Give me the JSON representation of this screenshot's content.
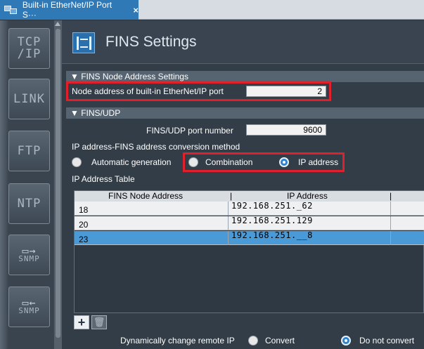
{
  "tab": {
    "title": "Built-in EtherNet/IP Port S···",
    "close": "×"
  },
  "sidebar": {
    "items": [
      {
        "label": "TCP /IP"
      },
      {
        "label": "LINK"
      },
      {
        "label": "FTP"
      },
      {
        "label": "NTP"
      },
      {
        "label": "SNMP"
      },
      {
        "label": "SNMP"
      }
    ]
  },
  "header": {
    "title": "FINS Settings"
  },
  "node_section": {
    "title": "▼ FINS Node Address Settings",
    "node_label": "Node address of built-in EtherNet/IP port",
    "node_value": "2"
  },
  "udp_section": {
    "title": "▼ FINS/UDP",
    "port_label": "FINS/UDP port number",
    "port_value": "9600",
    "conversion_label": "IP address-FINS address conversion method",
    "options": [
      {
        "label": "Automatic generation",
        "selected": false
      },
      {
        "label": "Combination",
        "selected": false
      },
      {
        "label": "IP address",
        "selected": true
      }
    ],
    "table_label": "IP Address Table"
  },
  "table": {
    "columns": [
      "FINS Node Address",
      "IP Address"
    ],
    "rows": [
      {
        "node": "18",
        "ip": "192.168.251._62",
        "selected": false
      },
      {
        "node": "20",
        "ip": "192.168.251.129",
        "selected": false
      },
      {
        "node": "23",
        "ip": "192.168.251.__8",
        "selected": true
      }
    ]
  },
  "toolbar": {
    "add": "+",
    "delete": "🗑"
  },
  "dynamic": {
    "label": "Dynamically change remote IP",
    "options": [
      {
        "label": "Convert",
        "selected": false
      },
      {
        "label": "Do not convert",
        "selected": true
      }
    ]
  }
}
